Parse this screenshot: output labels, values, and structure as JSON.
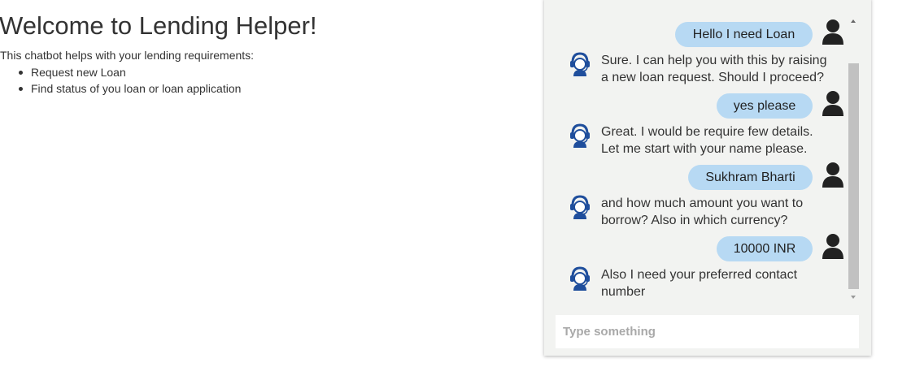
{
  "intro": {
    "title": "Welcome to Lending Helper!",
    "description": "This chatbot helps with your lending requirements:",
    "items": [
      "Request new Loan",
      "Find status of you loan or loan application"
    ]
  },
  "chat": {
    "messages": [
      {
        "from": "user",
        "text": "Hello I need Loan"
      },
      {
        "from": "bot",
        "line1": "Sure. I can help you with this by raising",
        "line2": "a new loan request. Should I proceed?"
      },
      {
        "from": "user",
        "text": "yes please"
      },
      {
        "from": "bot",
        "line1": "Great. I would be require few details.",
        "line2": "Let me start with your name please."
      },
      {
        "from": "user",
        "text": "Sukhram Bharti"
      },
      {
        "from": "bot",
        "line1": "and how much amount you want to",
        "line2": "borrow? Also in which currency?"
      },
      {
        "from": "user",
        "text": "10000 INR"
      },
      {
        "from": "bot",
        "line1": "Also I need your preferred contact",
        "line2": "number"
      }
    ],
    "input_placeholder": "Type something"
  },
  "colors": {
    "user_bubble": "#b7d9f3",
    "bot_icon": "#1f4e9c",
    "user_icon": "#222222",
    "chat_background": "#f2f3f1"
  },
  "icons": {
    "user": "user-silhouette-icon",
    "bot": "support-agent-headset-icon"
  }
}
